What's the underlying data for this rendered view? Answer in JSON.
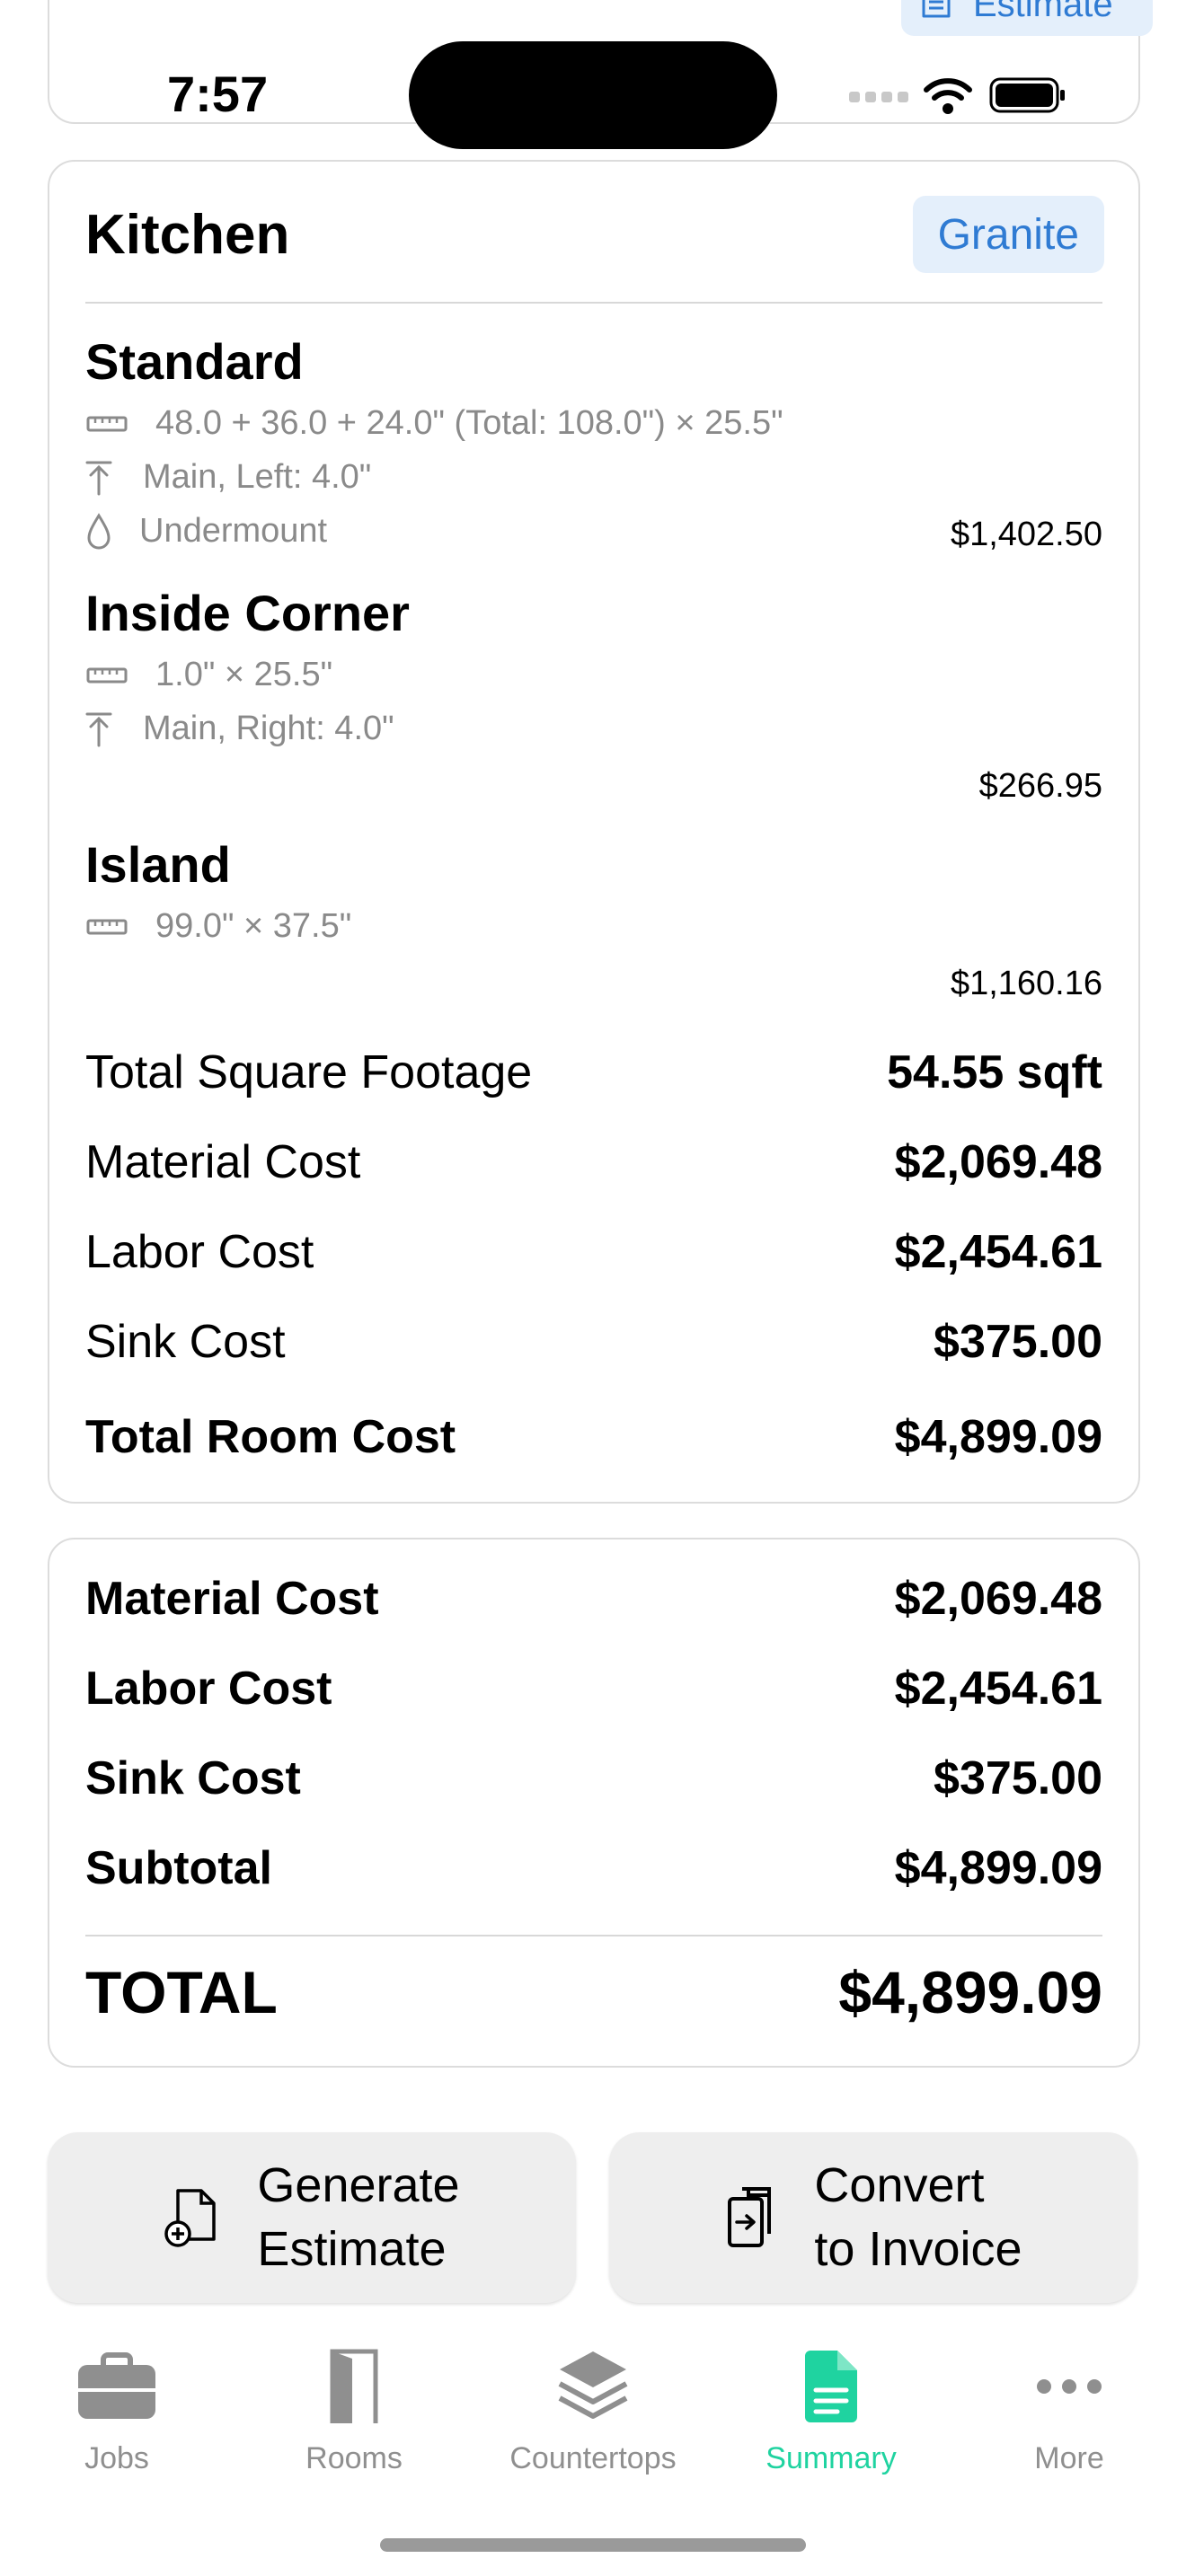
{
  "status": {
    "time": "7:57"
  },
  "top_card": {
    "badge_label": "Estimate",
    "badge_icon": "document-icon"
  },
  "room": {
    "title": "Kitchen",
    "material": "Granite",
    "sections": [
      {
        "name": "Standard",
        "dimensions": "48.0 + 36.0 + 24.0\" (Total: 108.0\") × 25.5\"",
        "backsplash": "Main, Left: 4.0\"",
        "sink": "Undermount",
        "price": "$1,402.50"
      },
      {
        "name": "Inside Corner",
        "dimensions": "1.0\" × 25.5\"",
        "backsplash": "Main, Right: 4.0\"",
        "price": "$266.95"
      },
      {
        "name": "Island",
        "dimensions": "99.0\" × 37.5\"",
        "price": "$1,160.16"
      }
    ],
    "totals": {
      "sqft_label": "Total Square Footage",
      "sqft_value": "54.55 sqft",
      "material_label": "Material Cost",
      "material_value": "$2,069.48",
      "labor_label": "Labor Cost",
      "labor_value": "$2,454.61",
      "sink_label": "Sink Cost",
      "sink_value": "$375.00",
      "room_total_label": "Total Room Cost",
      "room_total_value": "$4,899.09"
    }
  },
  "summary": {
    "material_label": "Material Cost",
    "material_value": "$2,069.48",
    "labor_label": "Labor Cost",
    "labor_value": "$2,454.61",
    "sink_label": "Sink Cost",
    "sink_value": "$375.00",
    "subtotal_label": "Subtotal",
    "subtotal_value": "$4,899.09",
    "total_label": "TOTAL",
    "total_value": "$4,899.09"
  },
  "actions": {
    "generate_line1": "Generate",
    "generate_line2": "Estimate",
    "convert_line1": "Convert",
    "convert_line2": "to Invoice"
  },
  "tabs": [
    {
      "label": "Jobs",
      "icon": "briefcase-icon"
    },
    {
      "label": "Rooms",
      "icon": "door-icon"
    },
    {
      "label": "Countertops",
      "icon": "layers-icon"
    },
    {
      "label": "Summary",
      "icon": "document-icon"
    },
    {
      "label": "More",
      "icon": "ellipsis-icon"
    }
  ],
  "colors": {
    "accent": "#2f7bd3",
    "active_tab": "#1fd3a0",
    "inactive_tab": "#8f8f8f",
    "muted_text": "#8a8a8a"
  }
}
